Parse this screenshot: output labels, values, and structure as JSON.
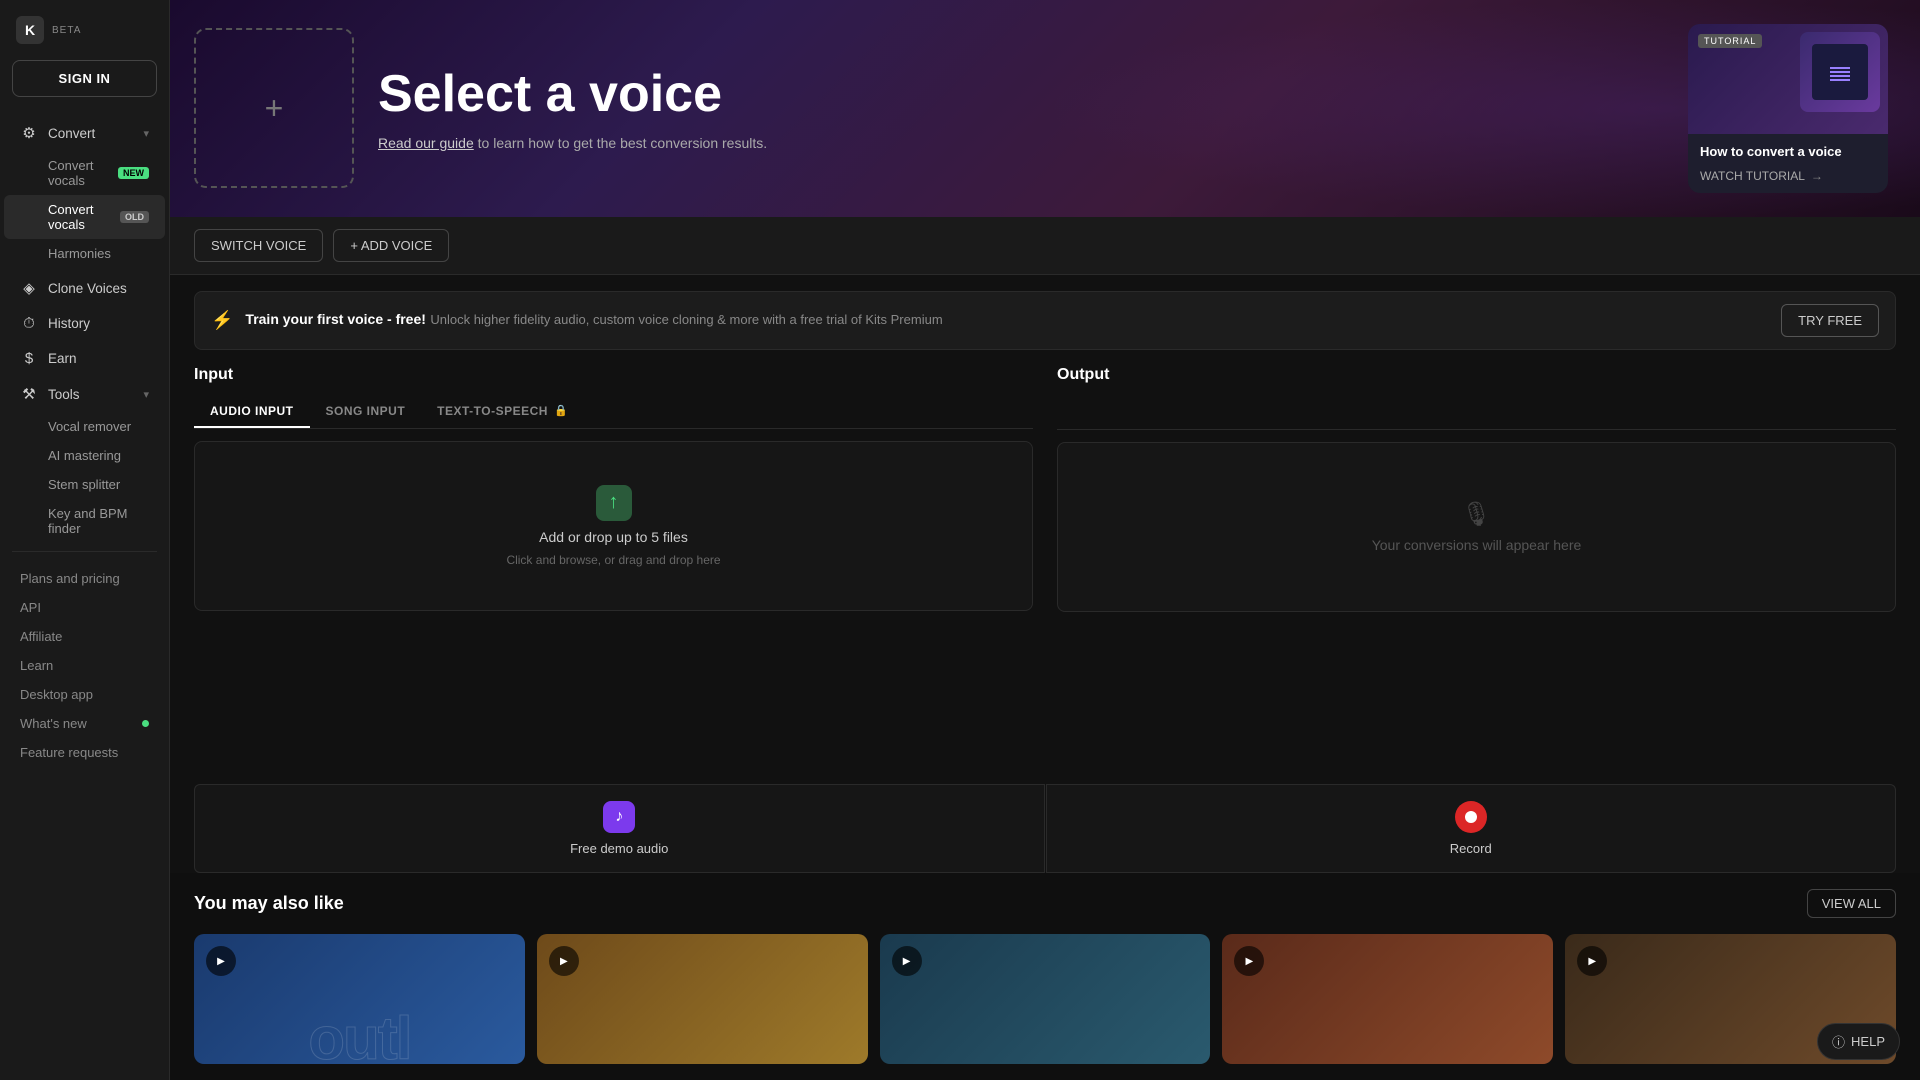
{
  "app": {
    "logo_text": "K",
    "beta_label": "BETA"
  },
  "sidebar": {
    "sign_in_label": "SIGN IN",
    "items": [
      {
        "id": "convert",
        "label": "Convert",
        "icon": "⚙",
        "has_chevron": true,
        "active": false
      },
      {
        "id": "clone-voices",
        "label": "Clone Voices",
        "icon": "◈",
        "active": false
      },
      {
        "id": "history",
        "label": "History",
        "icon": "⏱",
        "active": false
      },
      {
        "id": "earn",
        "label": "Earn",
        "icon": "$",
        "active": false
      },
      {
        "id": "tools",
        "label": "Tools",
        "icon": "⚒",
        "has_chevron": true,
        "active": false
      }
    ],
    "convert_sub": [
      {
        "id": "convert-vocals-new",
        "label": "Convert vocals",
        "badge": "NEW"
      },
      {
        "id": "convert-vocals-old",
        "label": "Convert vocals",
        "badge": "OLD",
        "active": true
      },
      {
        "id": "harmonies",
        "label": "Harmonies"
      }
    ],
    "tools_sub": [
      {
        "id": "vocal-remover",
        "label": "Vocal remover"
      },
      {
        "id": "ai-mastering",
        "label": "AI mastering"
      },
      {
        "id": "stem-splitter",
        "label": "Stem splitter"
      },
      {
        "id": "key-bpm",
        "label": "Key and BPM finder"
      }
    ],
    "bottom_links": [
      {
        "id": "plans",
        "label": "Plans and pricing"
      },
      {
        "id": "api",
        "label": "API"
      },
      {
        "id": "affiliate",
        "label": "Affiliate"
      },
      {
        "id": "learn",
        "label": "Learn"
      },
      {
        "id": "desktop",
        "label": "Desktop app"
      },
      {
        "id": "whats-new",
        "label": "What's new",
        "has_dot": true
      },
      {
        "id": "feature-requests",
        "label": "Feature requests"
      }
    ]
  },
  "hero": {
    "title": "Select a voice",
    "subtitle_text": "Read our guide",
    "subtitle_rest": " to learn how to get the best conversion results.",
    "voice_placeholder_icon": "+"
  },
  "tutorial": {
    "badge": "TUTORIAL",
    "title": "How to convert a voice",
    "watch_label": "WATCH TUTORIAL"
  },
  "voice_bar": {
    "switch_label": "SWITCH VOICE",
    "add_label": "+ ADD VOICE"
  },
  "promo": {
    "title": "Train your first voice - free!",
    "description": "Unlock higher fidelity audio, custom voice cloning & more with a free trial of Kits Premium",
    "cta_label": "TRY FREE"
  },
  "input": {
    "section_title": "Input",
    "tabs": [
      {
        "id": "audio-input",
        "label": "AUDIO INPUT",
        "active": true
      },
      {
        "id": "song-input",
        "label": "SONG INPUT",
        "active": false
      },
      {
        "id": "text-to-speech",
        "label": "TEXT-TO-SPEECH",
        "locked": true,
        "active": false
      }
    ],
    "upload_main": "Add or drop up to 5 files",
    "upload_sub": "Click and browse, or drag and drop here",
    "demo_label": "Free demo audio",
    "record_label": "Record"
  },
  "output": {
    "section_title": "Output",
    "placeholder_text": "Your conversions will appear here"
  },
  "recommendations": {
    "title": "You may also like",
    "view_all_label": "VIEW ALL",
    "cards": [
      {
        "id": 1,
        "color_class": "rec-card-1"
      },
      {
        "id": 2,
        "color_class": "rec-card-2"
      },
      {
        "id": 3,
        "color_class": "rec-card-3"
      },
      {
        "id": 4,
        "color_class": "rec-card-4"
      },
      {
        "id": 5,
        "color_class": "rec-card-5"
      }
    ],
    "outline_text": "outle"
  },
  "help": {
    "label": "HELP"
  }
}
